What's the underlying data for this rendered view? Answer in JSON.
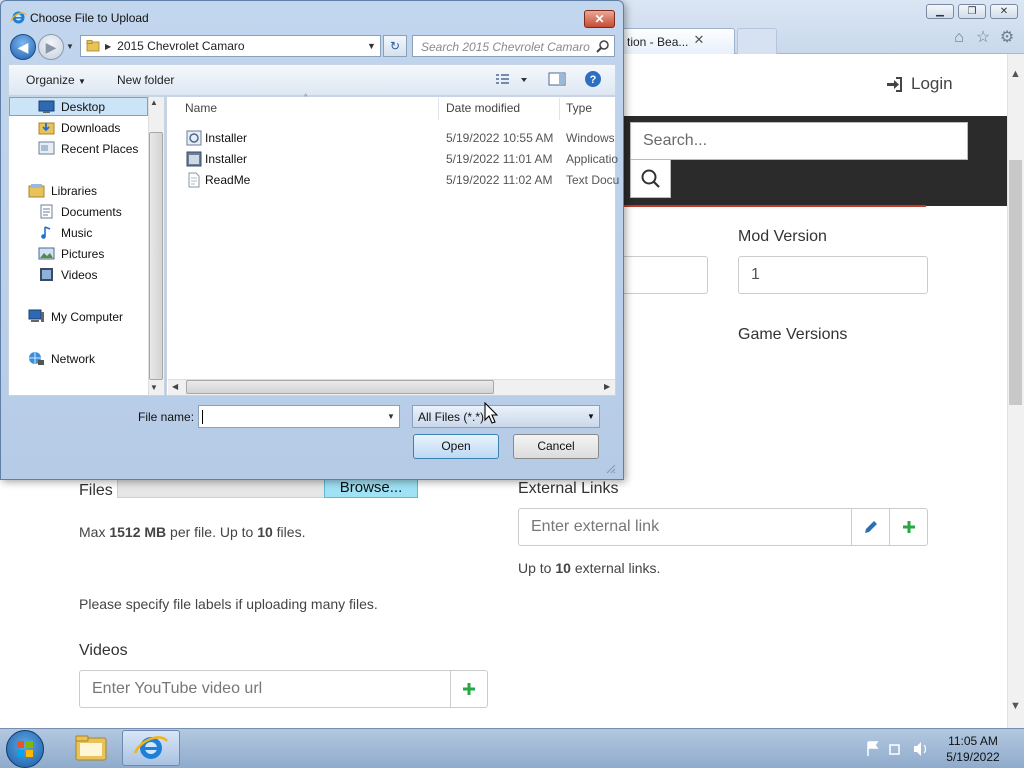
{
  "ie": {
    "tab_label": "tion - Bea...",
    "tab_close": "✕",
    "home_icon": "home-icon",
    "star_icon": "star-icon",
    "gear_icon": "gear-icon"
  },
  "page": {
    "login": "Login",
    "search_placeholder": "Search...",
    "mod_version_label": "Mod Version",
    "mod_version_value": "1",
    "game_versions_label": "Game Versions",
    "files_label": "Files",
    "browse_label": "Browse...",
    "files_hint_pre": "Max ",
    "files_hint_size": "1512 MB",
    "files_hint_mid": " per file. Up to ",
    "files_hint_count": "10",
    "files_hint_post": " files.",
    "file_labels_hint": "Please specify file labels if uploading many files.",
    "external_links_label": "External Links",
    "external_link_placeholder": "Enter external link",
    "external_hint_pre": "Up to ",
    "external_hint_count": "10",
    "external_hint_post": " external links.",
    "videos_label": "Videos",
    "video_placeholder": "Enter YouTube video url",
    "accent_green": "#28a745",
    "accent_blue": "#2a6fb5",
    "navbar_color": "#2b2b2b"
  },
  "dialog": {
    "title": "Choose File to Upload",
    "close": "✕",
    "address": "2015 Chevrolet Camaro",
    "search_placeholder": "Search 2015 Chevrolet Camaro",
    "organize": "Organize",
    "new_folder": "New folder",
    "sidebar": [
      {
        "label": "Desktop",
        "icon": "desktop-icon",
        "selected": true
      },
      {
        "label": "Downloads",
        "icon": "downloads-folder-icon"
      },
      {
        "label": "Recent Places",
        "icon": "recent-places-icon"
      },
      {
        "label": "Libraries",
        "icon": "libraries-icon"
      },
      {
        "label": "Documents",
        "icon": "documents-icon"
      },
      {
        "label": "Music",
        "icon": "music-icon"
      },
      {
        "label": "Pictures",
        "icon": "pictures-icon"
      },
      {
        "label": "Videos",
        "icon": "videos-icon"
      },
      {
        "label": "My Computer",
        "icon": "computer-icon"
      },
      {
        "label": "Network",
        "icon": "network-icon"
      }
    ],
    "columns": {
      "name": "Name",
      "date": "Date modified",
      "type": "Type"
    },
    "files": [
      {
        "name": "Installer",
        "date": "5/19/2022 10:55 AM",
        "type": "Windows",
        "icon": "installer-package-icon"
      },
      {
        "name": "Installer",
        "date": "5/19/2022 11:01 AM",
        "type": "Applicatio",
        "icon": "application-icon"
      },
      {
        "name": "ReadMe",
        "date": "5/19/2022 11:02 AM",
        "type": "Text Docu",
        "icon": "text-document-icon"
      }
    ],
    "file_name_label": "File name:",
    "file_name_value": "",
    "file_type": "All Files (*.*)",
    "open_button": "Open",
    "cancel_button": "Cancel"
  },
  "taskbar": {
    "time": "11:05 AM",
    "date": "5/19/2022"
  }
}
